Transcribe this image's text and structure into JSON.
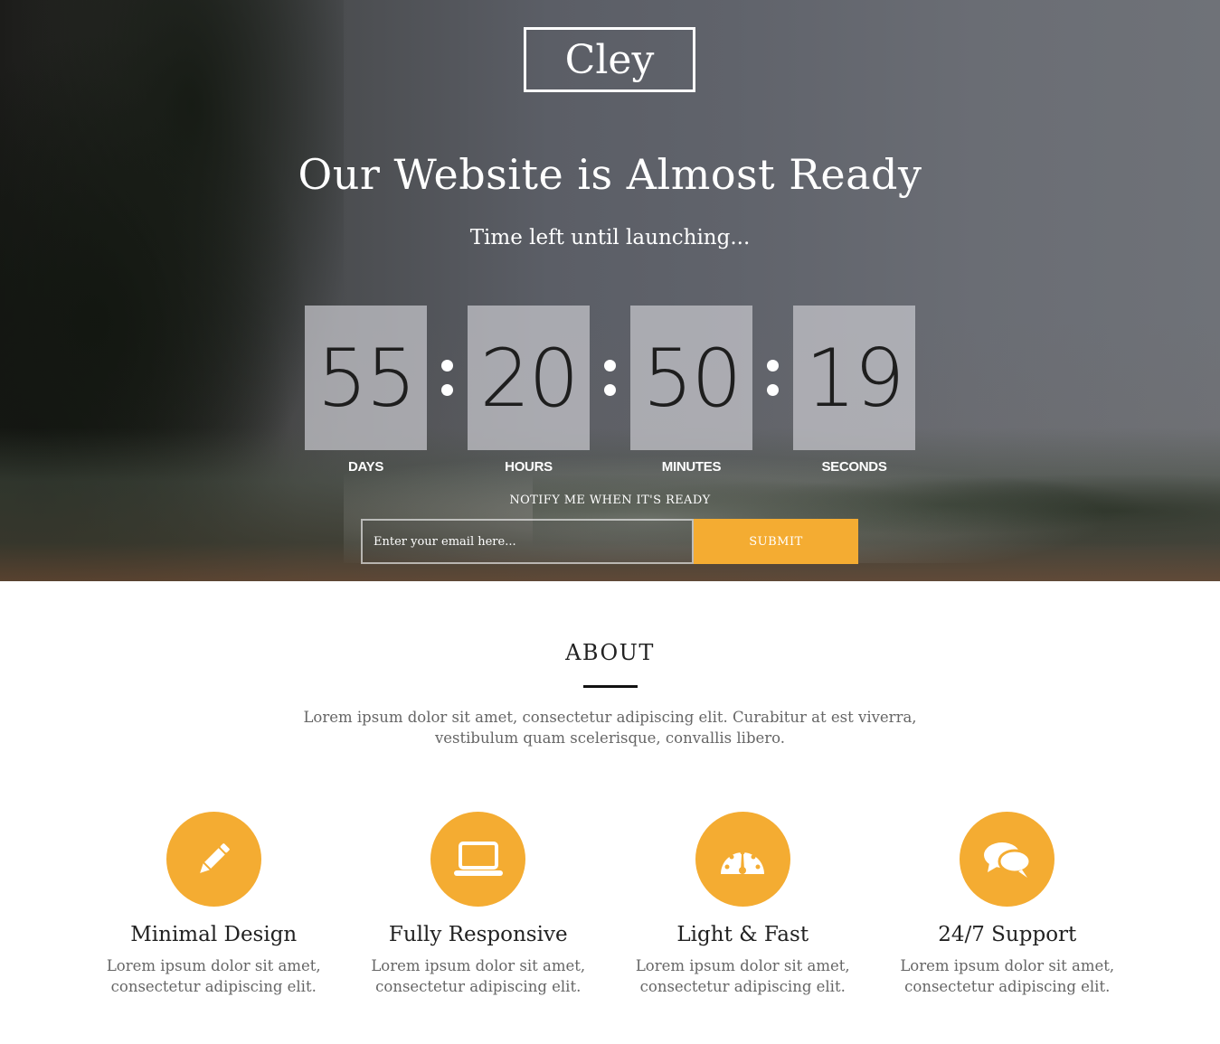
{
  "brand": {
    "logo_text": "Cley",
    "accent_color": "#f4ac32"
  },
  "hero": {
    "headline": "Our Website is Almost Ready",
    "subheadline": "Time left until launching...",
    "countdown": [
      {
        "value": "55",
        "label": "DAYS"
      },
      {
        "value": "20",
        "label": "HOURS"
      },
      {
        "value": "50",
        "label": "MINUTES"
      },
      {
        "value": "19",
        "label": "SECONDS"
      }
    ],
    "notify_label": "NOTIFY ME WHEN IT'S READY",
    "email_placeholder": "Enter your email here...",
    "submit_label": "SUBMIT"
  },
  "about": {
    "title": "ABOUT",
    "text": "Lorem ipsum dolor sit amet, consectetur adipiscing elit. Curabitur at est viverra, vestibulum quam scelerisque, convallis libero.",
    "features": [
      {
        "icon": "pencil-icon",
        "title": "Minimal Design",
        "text": "Lorem ipsum dolor sit amet, consectetur adipiscing elit."
      },
      {
        "icon": "laptop-icon",
        "title": "Fully Responsive",
        "text": "Lorem ipsum dolor sit amet, consectetur adipiscing elit."
      },
      {
        "icon": "speedometer-icon",
        "title": "Light & Fast",
        "text": "Lorem ipsum dolor sit amet, consectetur adipiscing elit."
      },
      {
        "icon": "chat-bubbles-icon",
        "title": "24/7 Support",
        "text": "Lorem ipsum dolor sit amet, consectetur adipiscing elit."
      }
    ]
  }
}
